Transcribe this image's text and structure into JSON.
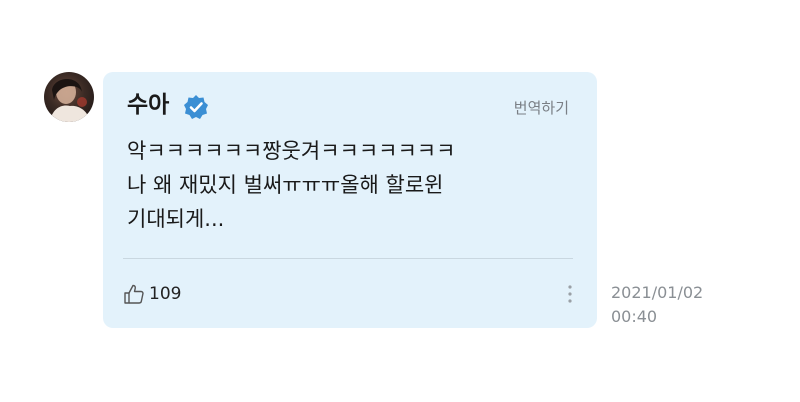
{
  "comment": {
    "author": "수아",
    "verified": true,
    "translate_label": "번역하기",
    "text_lines": [
      "악ㅋㅋㅋㅋㅋㅋ짱웃겨ㅋㅋㅋㅋㅋㅋㅋ",
      "나 왜 재밌지 벌써ㅠㅠㅠ올해 할로윈",
      "기대되게..."
    ],
    "like_count": "109",
    "date": "2021/01/02",
    "time": "00:40"
  },
  "icons": {
    "verified": "verified-badge-icon",
    "like": "thumbs-up-icon",
    "more": "more-vertical-icon"
  },
  "colors": {
    "bubble": "#e3f2fb",
    "verified": "#3b8fd4",
    "muted_text": "#8a8f94"
  }
}
